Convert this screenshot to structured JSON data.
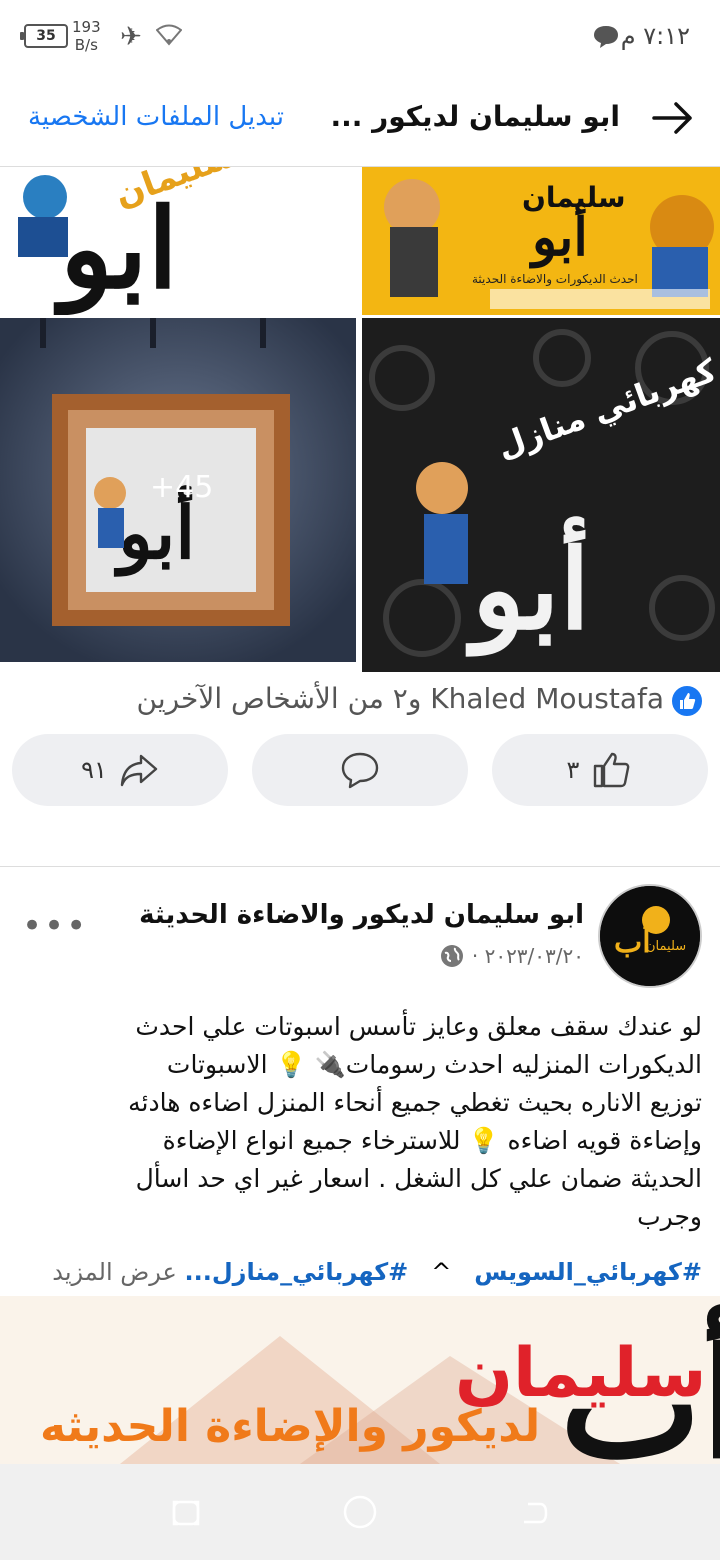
{
  "status_bar": {
    "time": "٧:١٢ م",
    "battery": "35",
    "net_speed_value": "193",
    "net_speed_unit": "B/s"
  },
  "header": {
    "page_name": "ابو سليمان لديكور ...",
    "switch_profiles": "تبديل الملفات الشخصية"
  },
  "gallery": {
    "more_count": "+45"
  },
  "reactions": {
    "reactors_text": "Khaled Moustafa و٢ من الأشخاص الآخرين",
    "like_count": "٣",
    "share_count": "٩١"
  },
  "post": {
    "author": "ابو سليمان لديكور والاضاءة الحديثة",
    "date": "٢٠٢٣/٠٣/٢٠ ·",
    "body_lines": [
      "لو عندك سقف معلق وعايز تأسس اسبوتات علي احدث",
      "الديكورات المنزليه احدث رسومات🔌 💡 الاسبوتات",
      "توزيع الاناره بحيث تغطي جميع أنحاء المنزل اضاءه هادئه",
      "وإضاءة قويه اضاءه 💡 للاسترخاء جميع انواع الإضاءة",
      "الحديثة ضمان علي كل الشغل . اسعار غير اي حد اسأل",
      "وجرب"
    ],
    "hashtag1": "#كهربائي_السويس",
    "hashtag2": "#كهربائي_منازل...",
    "see_more": "عرض المزيد",
    "caret": "^"
  },
  "colors": {
    "accent": "#1877f2",
    "hashtag": "#1565c0"
  },
  "icons": [
    "back-arrow-icon",
    "chat-bubble-icon",
    "airplane-icon",
    "wifi-icon",
    "like-icon",
    "comment-icon",
    "share-icon",
    "globe-icon",
    "more-icon"
  ]
}
